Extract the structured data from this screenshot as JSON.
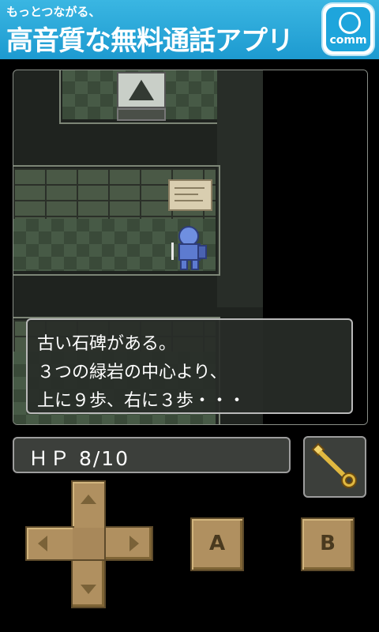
{
  "banner": {
    "small_text": "もっとつながる、",
    "headline": "高音質な無料通話アプリ",
    "app_icon_label": "comm"
  },
  "dialog": {
    "lines": [
      "古い石碑がある。",
      "３つの緑岩の中心より、",
      "上に９歩、右に３歩・・・"
    ]
  },
  "status": {
    "hp_text": "ＨＰ 8/10"
  },
  "inventory": {
    "item_icon": "golden-key-icon"
  },
  "controls": {
    "a_label": "A",
    "b_label": "B",
    "dpad_icon": "dpad-icon"
  },
  "colors": {
    "banner": "#1d9ad0",
    "button": "#b09060",
    "key": "#e0b840"
  }
}
